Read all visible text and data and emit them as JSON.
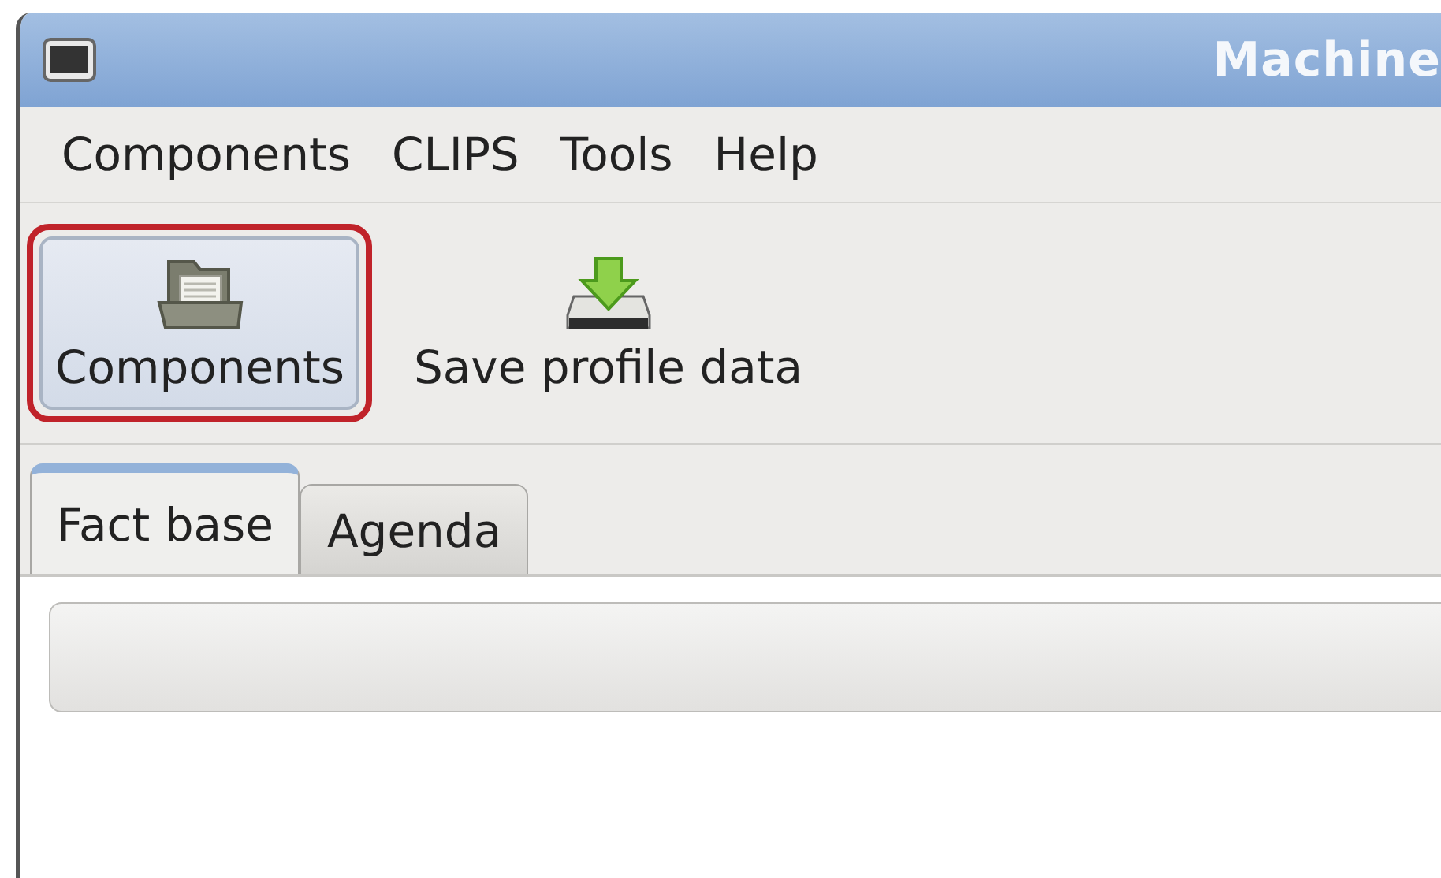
{
  "window": {
    "title": "Machine"
  },
  "menu": [
    {
      "label": "Components"
    },
    {
      "label": "CLIPS"
    },
    {
      "label": "Tools"
    },
    {
      "label": "Help"
    }
  ],
  "toolbar": [
    {
      "label": "Components",
      "active": true,
      "highlighted": true
    },
    {
      "label": "Save profile data",
      "active": false,
      "highlighted": false
    }
  ],
  "tabs": [
    {
      "label": "Fact base",
      "selected": true
    },
    {
      "label": "Agenda",
      "selected": false
    }
  ]
}
